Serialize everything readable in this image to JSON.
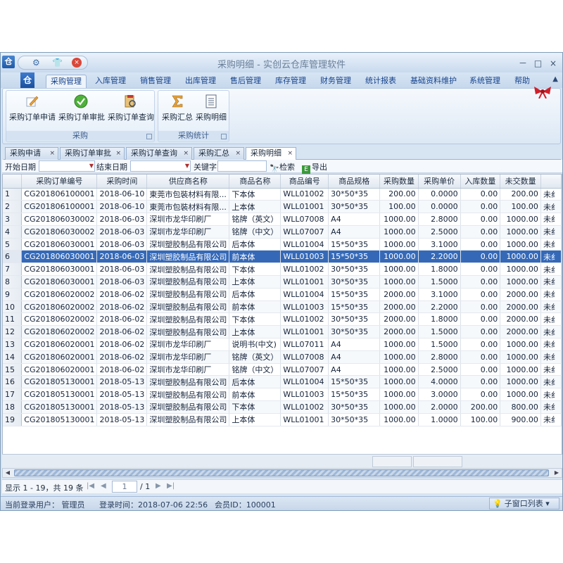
{
  "window": {
    "title": "采购明细 - 实创云仓库管理软件",
    "logo": "仓",
    "controls": [
      "－",
      "□",
      "×"
    ]
  },
  "ribbon_tabs": {
    "orb": "仓",
    "items": [
      "采购管理",
      "入库管理",
      "销售管理",
      "出库管理",
      "售后管理",
      "库存管理",
      "财务管理",
      "统计报表",
      "基础资料维护",
      "系统管理",
      "帮助"
    ],
    "active": "采购管理"
  },
  "ribbon": {
    "groups": [
      {
        "label": "采购",
        "buttons": [
          {
            "label": "采购订单申请",
            "icon": "edit-pencil-icon"
          },
          {
            "label": "采购订单审批",
            "icon": "check-circle-icon"
          },
          {
            "label": "采购订单查询",
            "icon": "search-doc-icon"
          }
        ]
      },
      {
        "label": "采购统计",
        "buttons": [
          {
            "label": "采购汇总",
            "icon": "sigma-icon"
          },
          {
            "label": "采购明细",
            "icon": "list-doc-icon"
          }
        ]
      }
    ]
  },
  "doc_tabs": {
    "items": [
      "采购申请",
      "采购订单审批",
      "采购订单查询",
      "采购汇总",
      "采购明细"
    ],
    "active": "采购明细"
  },
  "filter": {
    "start_label": "开始日期",
    "end_label": "结束日期",
    "keyword_label": "关键字",
    "search_button": "检索",
    "export_button": "导出"
  },
  "table": {
    "columns": [
      "",
      "采购订单编号",
      "采购时间",
      "供应商名称",
      "商品名称",
      "商品编号",
      "商品规格",
      "采购数量",
      "采购单价",
      "入库数量",
      "未交数量",
      ""
    ],
    "rows": [
      [
        "1",
        "CG201806100001",
        "2018-06-10",
        "東莞市包裝材料有限...",
        "下本体",
        "WLL01002",
        "30*50*35",
        "200.00",
        "0.0000",
        "0.00",
        "200.00",
        "未纟"
      ],
      [
        "2",
        "CG201806100001",
        "2018-06-10",
        "東莞市包裝材料有限...",
        "上本体",
        "WLL01001",
        "30*50*35",
        "100.00",
        "0.0000",
        "0.00",
        "100.00",
        "未纟"
      ],
      [
        "3",
        "CG201806030002",
        "2018-06-03",
        "深圳市龙华印刷厂",
        "铭牌（英文）",
        "WLL07008",
        "A4",
        "1000.00",
        "2.8000",
        "0.00",
        "1000.00",
        "未纟"
      ],
      [
        "4",
        "CG201806030002",
        "2018-06-03",
        "深圳市龙华印刷厂",
        "铭牌（中文）",
        "WLL07007",
        "A4",
        "1000.00",
        "2.5000",
        "0.00",
        "1000.00",
        "未纟"
      ],
      [
        "5",
        "CG201806030001",
        "2018-06-03",
        "深圳塑胶制品有限公司",
        "后本体",
        "WLL01004",
        "15*50*35",
        "1000.00",
        "3.1000",
        "0.00",
        "1000.00",
        "未纟"
      ],
      [
        "6",
        "CG201806030001",
        "2018-06-03",
        "深圳塑胶制品有限公司",
        "前本体",
        "WLL01003",
        "15*50*35",
        "1000.00",
        "2.2000",
        "0.00",
        "1000.00",
        "未纟"
      ],
      [
        "7",
        "CG201806030001",
        "2018-06-03",
        "深圳塑胶制品有限公司",
        "下本体",
        "WLL01002",
        "30*50*35",
        "1000.00",
        "1.8000",
        "0.00",
        "1000.00",
        "未纟"
      ],
      [
        "8",
        "CG201806030001",
        "2018-06-03",
        "深圳塑胶制品有限公司",
        "上本体",
        "WLL01001",
        "30*50*35",
        "1000.00",
        "1.5000",
        "0.00",
        "1000.00",
        "未纟"
      ],
      [
        "9",
        "CG201806020002",
        "2018-06-02",
        "深圳塑胶制品有限公司",
        "后本体",
        "WLL01004",
        "15*50*35",
        "2000.00",
        "3.1000",
        "0.00",
        "2000.00",
        "未纟"
      ],
      [
        "10",
        "CG201806020002",
        "2018-06-02",
        "深圳塑胶制品有限公司",
        "前本体",
        "WLL01003",
        "15*50*35",
        "2000.00",
        "2.2000",
        "0.00",
        "2000.00",
        "未纟"
      ],
      [
        "11",
        "CG201806020002",
        "2018-06-02",
        "深圳塑胶制品有限公司",
        "下本体",
        "WLL01002",
        "30*50*35",
        "2000.00",
        "1.8000",
        "0.00",
        "2000.00",
        "未纟"
      ],
      [
        "12",
        "CG201806020002",
        "2018-06-02",
        "深圳塑胶制品有限公司",
        "上本体",
        "WLL01001",
        "30*50*35",
        "2000.00",
        "1.5000",
        "0.00",
        "2000.00",
        "未纟"
      ],
      [
        "13",
        "CG201806020001",
        "2018-06-02",
        "深圳市龙华印刷厂",
        "说明书(中文)",
        "WLL07011",
        "A4",
        "1000.00",
        "1.5000",
        "0.00",
        "1000.00",
        "未纟"
      ],
      [
        "14",
        "CG201806020001",
        "2018-06-02",
        "深圳市龙华印刷厂",
        "铭牌（英文）",
        "WLL07008",
        "A4",
        "1000.00",
        "2.8000",
        "0.00",
        "1000.00",
        "未纟"
      ],
      [
        "15",
        "CG201806020001",
        "2018-06-02",
        "深圳市龙华印刷厂",
        "铭牌（中文）",
        "WLL07007",
        "A4",
        "1000.00",
        "2.5000",
        "0.00",
        "1000.00",
        "未纟"
      ],
      [
        "16",
        "CG201805130001",
        "2018-05-13",
        "深圳塑胶制品有限公司",
        "后本体",
        "WLL01004",
        "15*50*35",
        "1000.00",
        "4.0000",
        "0.00",
        "1000.00",
        "未纟"
      ],
      [
        "17",
        "CG201805130001",
        "2018-05-13",
        "深圳塑胶制品有限公司",
        "前本体",
        "WLL01003",
        "15*50*35",
        "1000.00",
        "3.0000",
        "0.00",
        "1000.00",
        "未纟"
      ],
      [
        "18",
        "CG201805130001",
        "2018-05-13",
        "深圳塑胶制品有限公司",
        "下本体",
        "WLL01002",
        "30*50*35",
        "1000.00",
        "2.0000",
        "200.00",
        "800.00",
        "未纟"
      ],
      [
        "19",
        "CG201805130001",
        "2018-05-13",
        "深圳塑胶制品有限公司",
        "上本体",
        "WLL01001",
        "30*50*35",
        "1000.00",
        "1.0000",
        "100.00",
        "900.00",
        "未纟"
      ]
    ],
    "selected_row": "6"
  },
  "pager": {
    "summary": "显示 1 - 19，共 19 条",
    "page_value": "1",
    "page_total": "/ 1"
  },
  "status": {
    "user": "当前登录用户：  管理员",
    "login_time": "登录时间：2018-07-06 22:56",
    "member_id": "会员ID：100001",
    "subwindow": "子窗口列表"
  },
  "colors": {
    "accent": "#3569b8",
    "title_text": "#6a7f99",
    "tab_text": "#15428b"
  }
}
